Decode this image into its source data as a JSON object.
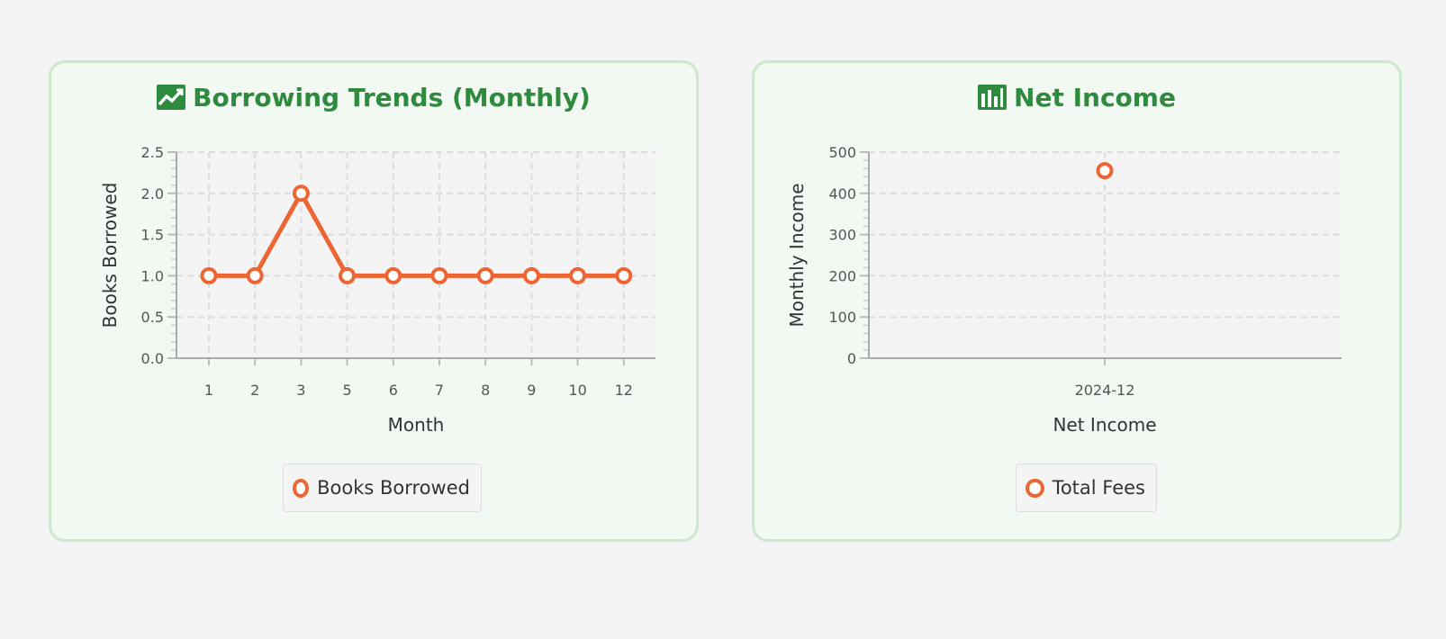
{
  "colors": {
    "series": "#ec6533",
    "title": "#2e8b3d",
    "card_bg": "#f2f8f2",
    "card_border": "#cde8cd",
    "plot_bg": "#f4f4f4",
    "grid": "#dcdcdc"
  },
  "cards": [
    {
      "title": "Borrowing Trends (Monthly)",
      "icon": "trend-chart-icon",
      "legend": "Books Borrowed"
    },
    {
      "title": "Net Income",
      "icon": "bar-chart-icon",
      "legend": "Total Fees"
    }
  ],
  "chart_data": [
    {
      "type": "line",
      "title": "Borrowing Trends (Monthly)",
      "xlabel": "Month",
      "ylabel": "Books Borrowed",
      "categories": [
        "1",
        "2",
        "3",
        "5",
        "6",
        "7",
        "8",
        "9",
        "10",
        "12"
      ],
      "series": [
        {
          "name": "Books Borrowed",
          "values": [
            1,
            1,
            2,
            1,
            1,
            1,
            1,
            1,
            1,
            1
          ]
        }
      ],
      "ylim": [
        0,
        2.5
      ],
      "yticks": [
        "0.0",
        "0.5",
        "1.0",
        "1.5",
        "2.0",
        "2.5"
      ],
      "grid": true,
      "legend_position": "bottom"
    },
    {
      "type": "scatter",
      "title": "Net Income",
      "xlabel": "Net Income",
      "ylabel": "Monthly Income",
      "categories": [
        "2024-12"
      ],
      "series": [
        {
          "name": "Total Fees",
          "values": [
            455
          ]
        }
      ],
      "ylim": [
        0,
        500
      ],
      "yticks": [
        "0",
        "100",
        "200",
        "300",
        "400",
        "500"
      ],
      "grid": true,
      "legend_position": "bottom"
    }
  ]
}
